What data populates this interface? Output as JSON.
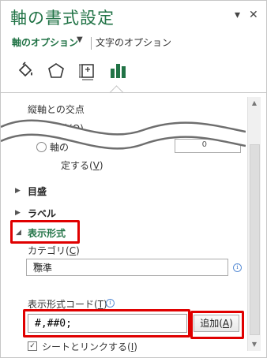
{
  "pane": {
    "title": "軸の書式設定",
    "tab_axis_options": "軸のオプション",
    "tab_caret": "▼",
    "tab_text_options": "文字のオプション",
    "close": "✕",
    "menu": "▾"
  },
  "icons": [
    "fill-line-icon",
    "effects-pentagon-icon",
    "size-properties-icon",
    "axis-options-bar-icon"
  ],
  "content": {
    "crossing_label": "縦軸との交点",
    "crossing_auto": "自動(",
    "crossing_auto_key": "O",
    "crossing_auto_end": ")",
    "crossing_value_prefix": "軸の",
    "crossing_value_box": "0",
    "crossing_max_tail": "定する(",
    "crossing_max_key": "V",
    "crossing_max_end": ")",
    "section_tickmarks": "目盛",
    "section_labels": "ラベル",
    "section_number": "表示形式",
    "category_label": "カテゴリ(",
    "category_key": "C",
    "category_end": ")",
    "category_value": "標準",
    "format_code_label": "表示形式コード(",
    "format_code_key": "T",
    "format_code_end": ")",
    "format_code_value": "#,##0;",
    "add_button": "追加(",
    "add_button_key": "A",
    "add_button_end": ")",
    "link_label": "シートとリンクする(",
    "link_key": "I",
    "link_end": ")"
  },
  "colors": {
    "accent_green": "#217346",
    "highlight_red": "#e00000"
  }
}
